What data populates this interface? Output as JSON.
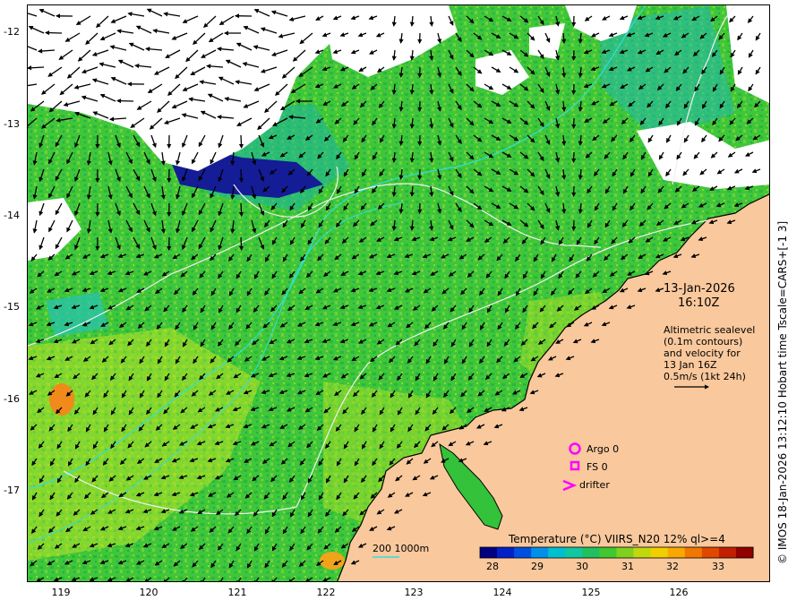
{
  "map": {
    "lat_ticks": [
      "-12",
      "-13",
      "-14",
      "-15",
      "-16",
      "-17"
    ],
    "lon_ticks": [
      "119",
      "120",
      "121",
      "122",
      "123",
      "124",
      "125",
      "126"
    ],
    "lat_range": [
      -17.95,
      -11.65
    ],
    "lon_range": [
      118.6,
      127.0
    ]
  },
  "annotations": {
    "date": "13-Jan-2026",
    "time": "16:10Z",
    "desc": [
      "Altimetric sealevel",
      "(0.1m contours)",
      "and velocity for",
      "13 Jan 16Z",
      "0.5m/s (1kt 24h)"
    ]
  },
  "legend": {
    "argo": "Argo 0",
    "fs": "FS 0",
    "drifter": "drifter",
    "isobath": "200  1000m"
  },
  "colorbar": {
    "title": "Temperature (°C) VIIRS_N20 12% ql>=4",
    "ticks": [
      "28",
      "29",
      "30",
      "31",
      "32",
      "33"
    ],
    "range": [
      27.3,
      33.8
    ]
  },
  "credit": "© IMOS 18-Jan-2026 13:12:10 Hobart time Tscale=CARS+[-1 3]",
  "colors": {
    "land": "#f9c89c",
    "cloud": "#ffffff",
    "sst_main": "#33c23a",
    "marker": "#ff00ff",
    "isobath": "#33dddd"
  }
}
